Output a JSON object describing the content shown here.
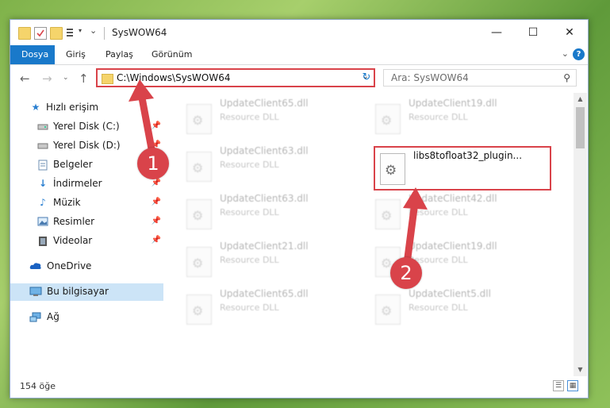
{
  "window": {
    "title": "SysWOW64",
    "minimize": "—",
    "maximize": "☐",
    "close": "✕"
  },
  "ribbon": {
    "tabs": [
      "Dosya",
      "Giriş",
      "Paylaş",
      "Görünüm"
    ]
  },
  "nav": {
    "address": "C:\\Windows\\SysWOW64",
    "search_placeholder": "Ara: SysWOW64"
  },
  "sidebar": {
    "items": [
      {
        "label": "Hızlı erişim",
        "icon": "star-icon"
      },
      {
        "label": "Yerel Disk (C:)",
        "icon": "drive-icon",
        "pinned": true
      },
      {
        "label": "Yerel Disk (D:)",
        "icon": "drive-icon",
        "pinned": true
      },
      {
        "label": "Belgeler",
        "icon": "documents-icon",
        "pinned": true
      },
      {
        "label": "İndirmeler",
        "icon": "download-icon",
        "pinned": true
      },
      {
        "label": "Müzik",
        "icon": "music-icon",
        "pinned": true
      },
      {
        "label": "Resimler",
        "icon": "pictures-icon",
        "pinned": true
      },
      {
        "label": "Videolar",
        "icon": "videos-icon",
        "pinned": true
      },
      {
        "label": "OneDrive",
        "icon": "cloud-icon"
      },
      {
        "label": "Bu bilgisayar",
        "icon": "computer-icon",
        "selected": true
      },
      {
        "label": "Ağ",
        "icon": "network-icon"
      }
    ]
  },
  "files": [
    {
      "name": "UpdateClient65.dll",
      "type": "Resource DLL"
    },
    {
      "name": "UpdateClient19.dll",
      "type": "Resource DLL"
    },
    {
      "name": "UpdateClient63.dll",
      "type": "Resource DLL"
    },
    {
      "name": "libs8tofloat32_plugin...",
      "type": ""
    },
    {
      "name": "UpdateClient63.dll",
      "type": "Resource DLL"
    },
    {
      "name": "UpdateClient42.dll",
      "type": "Resource DLL"
    },
    {
      "name": "UpdateClient21.dll",
      "type": "Resource DLL"
    },
    {
      "name": "UpdateClient19.dll",
      "type": "Resource DLL"
    },
    {
      "name": "UpdateClient65.dll",
      "type": "Resource DLL"
    },
    {
      "name": "UpdateClient5.dll",
      "type": "Resource DLL"
    }
  ],
  "status": {
    "count": "154 öğe"
  },
  "annotations": {
    "step1": "1",
    "step2": "2",
    "color": "#d9434a"
  }
}
